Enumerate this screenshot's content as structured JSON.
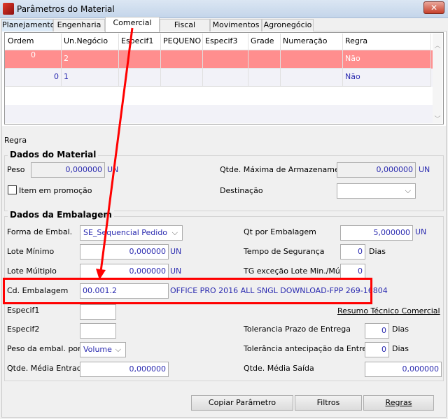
{
  "window": {
    "title": "Parâmetros do Material",
    "close": "✕"
  },
  "tabs": [
    "Planejamento",
    "Engenharia",
    "Comercial",
    "Fiscal",
    "Movimentos",
    "Agronegócio"
  ],
  "active_tab": "Comercial",
  "grid": {
    "columns": [
      "Ordem",
      "Un.Negócio",
      "Especif1",
      "PEQUENO",
      "Especif3",
      "Grade",
      "Numeração",
      "Regra"
    ],
    "rows": [
      [
        "0",
        "2",
        "",
        "",
        "",
        "",
        "",
        "Não"
      ],
      [
        "0",
        "1",
        "",
        "",
        "",
        "",
        "",
        "Não"
      ]
    ],
    "selected_row_color": "#ff8e8e"
  },
  "regra_label": "Regra",
  "dados_material": {
    "title": "Dados do Material",
    "peso_label": "Peso",
    "peso": "0,000000",
    "peso_unit": "UN",
    "qtde_max_label": "Qtde. Máxima de Armazenamento",
    "qtde_max": "0,000000",
    "qtde_max_unit": "UN",
    "promo_label": "Item em promoção",
    "promo_checked": false,
    "destinacao_label": "Destinação",
    "destinacao": ""
  },
  "dados_embalagem": {
    "title": "Dados da Embalagem",
    "forma_label": "Forma de Embal.",
    "forma": "SE_Sequencial Pedido",
    "qt_emb_label": "Qt por Embalagem",
    "qt_emb": "5,000000",
    "qt_emb_unit": "UN",
    "lote_min_label": "Lote Mínimo",
    "lote_min": "0,000000",
    "lote_min_unit": "UN",
    "tempo_seg_label": "Tempo de Segurança",
    "tempo_seg": "0",
    "tempo_seg_unit": "Dias",
    "lote_mult_label": "Lote Múltiplo",
    "lote_mult": "0,000000",
    "lote_mult_unit": "UN",
    "tg_label": "TG exceção Lote Min./Múlt.",
    "tg": "0",
    "cd_emb_label": "Cd. Embalagem",
    "cd_emb": "00.001.2",
    "cd_emb_desc": "OFFICE PRO 2016 ALL SNGL DOWNLOAD-FPP 269-16804",
    "especif1_label": "Especif1",
    "especif1": "",
    "resumo_link": "Resumo Técnico Comercial",
    "especif2_label": "Especif2",
    "especif2": "",
    "tol_prazo_label": "Tolerancia Prazo de Entrega",
    "tol_prazo": "0",
    "tol_prazo_unit": "Dias",
    "peso_emb_label": "Peso da embal. por",
    "peso_emb": "Volume",
    "tol_antec_label": "Tolerância antecipação da Entrega",
    "tol_antec": "0",
    "tol_antec_unit": "Dias",
    "media_ent_label": "Qtde. Média Entrada",
    "media_ent": "0,000000",
    "media_sai_label": "Qtde. Média Saída",
    "media_sai": "0,000000"
  },
  "buttons": {
    "copiar": "Copiar Parâmetro",
    "filtros": "Filtros",
    "regras": "Regras"
  },
  "annotation_color": "#ff0000"
}
